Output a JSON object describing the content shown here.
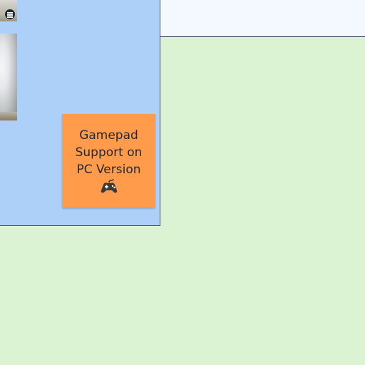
{
  "canvas": {
    "colors": {
      "board_background": "#dcf3d3",
      "top_strip": "#f3f9ff",
      "frame_background": "#acd0f7",
      "sticky_note": "#ff9b4a"
    }
  },
  "sticky_note": {
    "text": "Gamepad Support on PC Version",
    "icon": "gamepad-icon"
  },
  "toolbar": {
    "menu_icon": "menu-icon"
  }
}
